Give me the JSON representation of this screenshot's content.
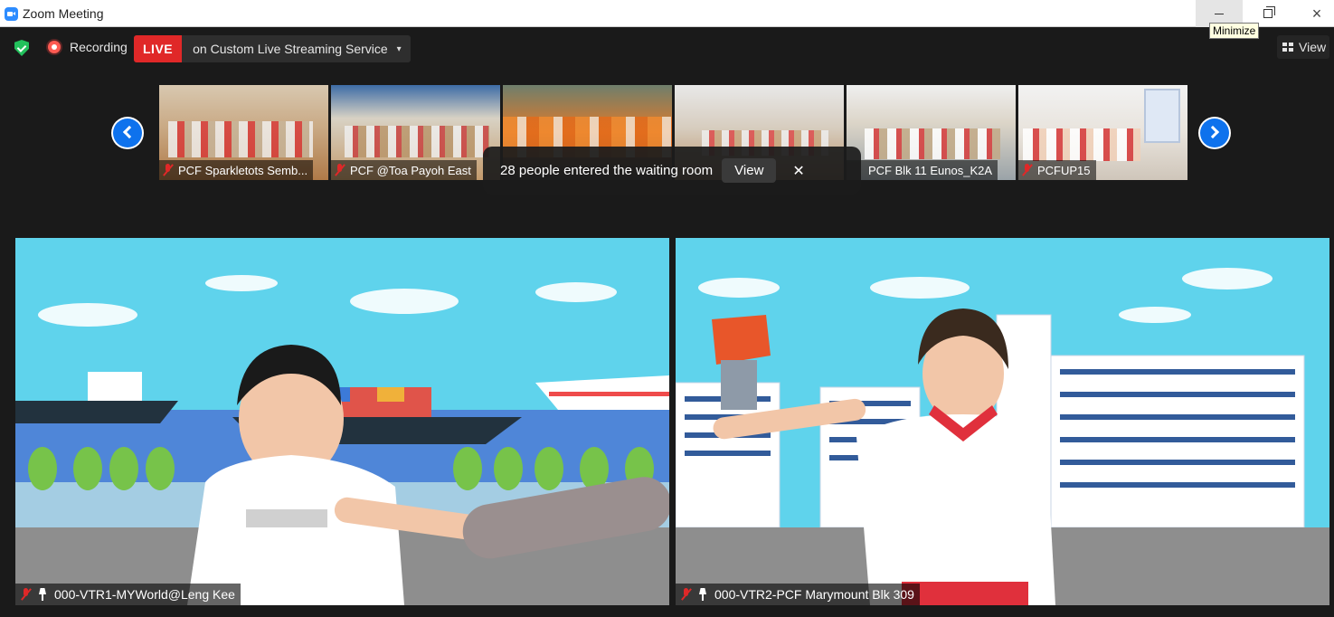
{
  "window": {
    "title": "Zoom Meeting",
    "minimize_tooltip": "Minimize",
    "close_glyph": "×"
  },
  "toolbar": {
    "recording_label": "Recording",
    "live_badge": "LIVE",
    "live_stream_text": "on Custom Live Streaming Service",
    "live_caret": "▾",
    "view_label": "View"
  },
  "thumbnails": [
    {
      "name": "PCF Sparkletots Semb...",
      "muted": true
    },
    {
      "name": "PCF @Toa Payoh East",
      "muted": true
    },
    {
      "name": "",
      "muted": false
    },
    {
      "name": "",
      "muted": false
    },
    {
      "name": "PCF Blk 11 Eunos_K2A",
      "muted": false
    },
    {
      "name": "PCFUP15",
      "muted": true
    }
  ],
  "notification": {
    "message": "28 people entered the waiting room",
    "view_button": "View",
    "close_glyph": "✕"
  },
  "main_videos": [
    {
      "name": "000-VTR1-MYWorld@Leng Kee",
      "muted": true,
      "pinned": true
    },
    {
      "name": "000-VTR2-PCF Marymount Blk 309",
      "muted": true,
      "pinned": true
    }
  ],
  "colors": {
    "accent_blue": "#0e72ed",
    "live_red": "#e02828",
    "shield_green": "#23c05c",
    "background": "#1a1a1a"
  },
  "icons": [
    "zoom-app-icon",
    "shield-icon",
    "recording-icon",
    "grid-view-icon",
    "chevron-left-icon",
    "chevron-right-icon",
    "mic-muted-icon",
    "pin-icon"
  ]
}
